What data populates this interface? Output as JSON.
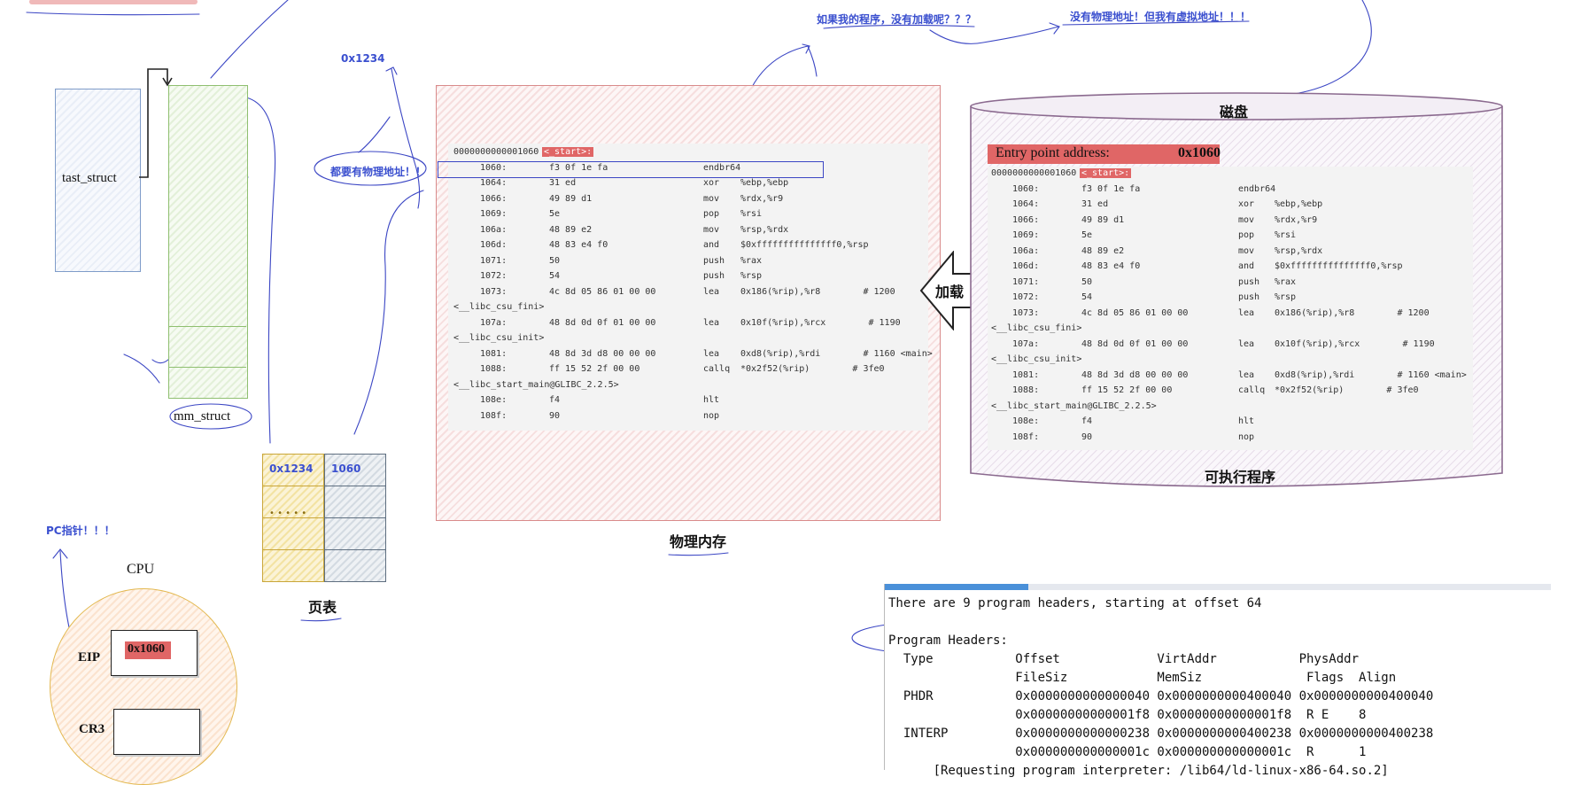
{
  "top_notes": {
    "not_loaded": "如果我的程序，没有加载呢？？？",
    "no_physical": "没有物理地址！但我有虚拟地址！！！",
    "addr_0x1234": "0x1234",
    "has_physical": "都要有物理地址！！",
    "pc_pointer": "PC指针！！！"
  },
  "boxes": {
    "task_struct": "tast_struct",
    "mm_struct": "mm_struct",
    "page_table_caption": "页表",
    "page_table": {
      "virt": [
        "0x1234",
        "",
        "",
        ""
      ],
      "phys": [
        "1060",
        "",
        "",
        ""
      ],
      "dots": "• • • • •"
    },
    "physical_memory_caption": "物理内存",
    "load_arrow": "加载",
    "disk_title": "磁盘",
    "disk_caption": "可执行程序",
    "entry_label": "Entry point address:",
    "entry_value": "0x1060"
  },
  "cpu": {
    "title": "CPU",
    "eip_label": "EIP",
    "eip_value": "0x1060",
    "cr3_label": "CR3"
  },
  "disasm": {
    "header_addr": "0000000000001060",
    "header_sym": "<_start>:",
    "rows": [
      {
        "addr": "1060:",
        "bytes": "f3 0f 1e fa",
        "op": "endbr64",
        "args": ""
      },
      {
        "addr": "1064:",
        "bytes": "31 ed",
        "op": "xor",
        "args": "%ebp,%ebp"
      },
      {
        "addr": "1066:",
        "bytes": "49 89 d1",
        "op": "mov",
        "args": "%rdx,%r9"
      },
      {
        "addr": "1069:",
        "bytes": "5e",
        "op": "pop",
        "args": "%rsi"
      },
      {
        "addr": "106a:",
        "bytes": "48 89 e2",
        "op": "mov",
        "args": "%rsp,%rdx"
      },
      {
        "addr": "106d:",
        "bytes": "48 83 e4 f0",
        "op": "and",
        "args": "$0xfffffffffffffff0,%rsp"
      },
      {
        "addr": "1071:",
        "bytes": "50",
        "op": "push",
        "args": "%rax"
      },
      {
        "addr": "1072:",
        "bytes": "54",
        "op": "push",
        "args": "%rsp"
      },
      {
        "addr": "1073:",
        "bytes": "4c 8d 05 86 01 00 00",
        "op": "lea",
        "args": "0x186(%rip),%r8        # 1200"
      },
      {
        "cont": "<__libc_csu_fini>"
      },
      {
        "addr": "107a:",
        "bytes": "48 8d 0d 0f 01 00 00",
        "op": "lea",
        "args": "0x10f(%rip),%rcx        # 1190"
      },
      {
        "cont": "<__libc_csu_init>"
      },
      {
        "addr": "1081:",
        "bytes": "48 8d 3d d8 00 00 00",
        "op": "lea",
        "args": "0xd8(%rip),%rdi        # 1160 <main>"
      },
      {
        "addr": "1088:",
        "bytes": "ff 15 52 2f 00 00",
        "op": "callq",
        "args": "*0x2f52(%rip)        # 3fe0"
      },
      {
        "cont": "<__libc_start_main@GLIBC_2.2.5>"
      },
      {
        "addr": "108e:",
        "bytes": "f4",
        "op": "hlt",
        "args": ""
      },
      {
        "addr": "108f:",
        "bytes": "90",
        "op": "nop",
        "args": ""
      }
    ]
  },
  "terminal": {
    "lines": [
      "There are 9 program headers, starting at offset 64",
      "",
      "Program Headers:",
      "  Type           Offset             VirtAddr           PhysAddr",
      "                 FileSiz            MemSiz              Flags  Align",
      "  PHDR           0x0000000000000040 0x0000000000400040 0x0000000000400040",
      "                 0x00000000000001f8 0x00000000000001f8  R E    8",
      "  INTERP         0x0000000000000238 0x0000000000400238 0x0000000000400238",
      "                 0x000000000000001c 0x000000000000001c  R      1",
      "      [Requesting program interpreter: /lib64/ld-linux-x86-64.so.2]"
    ]
  },
  "colors": {
    "annotation_blue": "#3a4fcf",
    "highlight_red": "#e06666",
    "ink": "#2e3a9c"
  }
}
